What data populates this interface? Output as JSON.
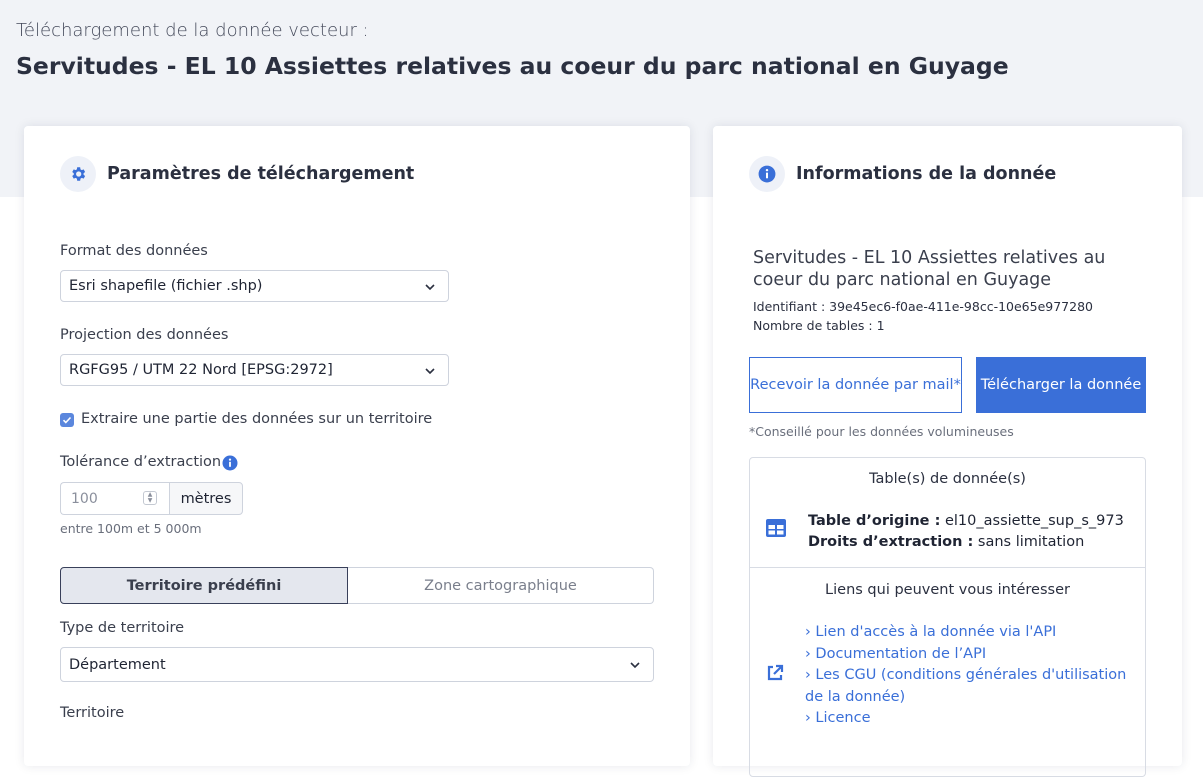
{
  "header": {
    "subtitle": "Téléchargement de la donnée vecteur :",
    "title": "Servitudes - EL 10 Assiettes relatives au coeur du parc national en Guyage"
  },
  "params": {
    "title": "Paramètres de téléchargement",
    "format_label": "Format des données",
    "format_value": "Esri shapefile (fichier .shp)",
    "projection_label": "Projection des données",
    "projection_value": "RGFG95 / UTM 22 Nord [EPSG:2972]",
    "extract_label": "Extraire une partie des données sur un territoire",
    "extract_checked": true,
    "tolerance_label": "Tolérance d’extraction",
    "tolerance_value": "100",
    "tolerance_unit": "mètres",
    "tolerance_hint": "entre 100m et 5 000m",
    "tab_predefined": "Territoire prédéfini",
    "tab_map": "Zone cartographique",
    "territory_type_label": "Type de territoire",
    "territory_type_value": "Département",
    "territory_label": "Territoire"
  },
  "info": {
    "title": "Informations de la donnée",
    "name": "Servitudes - EL 10 Assiettes relatives au coeur du parc national en Guyage",
    "identifier": "Identifiant : 39e45ec6-f0ae-411e-98cc-10e65e977280",
    "tables_count": "Nombre de tables : 1",
    "mail_button": "Recevoir la donnée par mail*",
    "download_button": "Télécharger la donnée",
    "footnote": "*Conseillé pour les données volumineuses",
    "tables_title": "Table(s) de donnée(s)",
    "origin_label": "Table d’origine :",
    "origin_value": "el10_assiette_sup_s_973",
    "rights_label": "Droits d’extraction :",
    "rights_value": "sans limitation",
    "links_title": "Liens qui peuvent vous intéresser",
    "links": [
      "Lien d'accès à la donnée via l'API",
      "Documentation de l’API",
      "Les CGU (conditions générales d'utilisation de la donnée)",
      "Licence"
    ]
  },
  "colors": {
    "accent": "#3a6fd8",
    "band": "#f1f3f7"
  }
}
